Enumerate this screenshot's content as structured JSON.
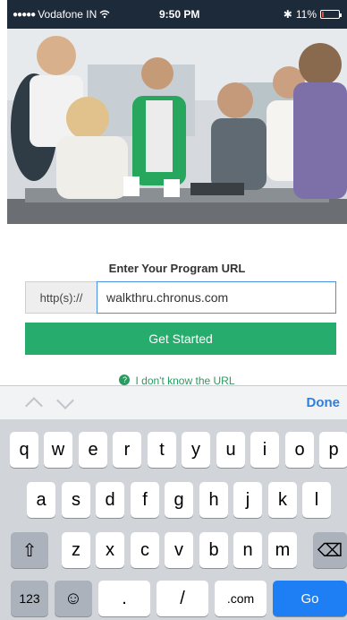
{
  "status_bar": {
    "signal": "●●●●●",
    "carrier": "Vodafone IN",
    "wifi_icon": "wifi-icon",
    "time": "9:50 PM",
    "bluetooth": "✱",
    "battery_percent": "11%",
    "battery_level": 0.11,
    "battery_color": "#e0483e"
  },
  "hero": {
    "description_icon": "team-meeting-photo"
  },
  "form": {
    "title": "Enter Your Program URL",
    "url_prefix": "http(s)://",
    "url_value": "walkthru.chronus.com",
    "submit_label": "Get Started",
    "help_link": "I don't know the URL"
  },
  "keyboard_toolbar": {
    "done_label": "Done"
  },
  "keyboard": {
    "row1": [
      "q",
      "w",
      "e",
      "r",
      "t",
      "y",
      "u",
      "i",
      "o",
      "p"
    ],
    "row2": [
      "a",
      "s",
      "d",
      "f",
      "g",
      "h",
      "j",
      "k",
      "l"
    ],
    "row3": [
      "z",
      "x",
      "c",
      "v",
      "b",
      "n",
      "m"
    ],
    "numbers_label": "123",
    "emoji": "☺",
    "period": ".",
    "slash": "/",
    "dotcom": ".com",
    "go_label": "Go",
    "shift_icon": "⇧",
    "backspace_icon": "⌫"
  },
  "colors": {
    "accent_green": "#26ad6d",
    "link_blue": "#2f7fd8",
    "go_blue": "#1e7ff4"
  }
}
